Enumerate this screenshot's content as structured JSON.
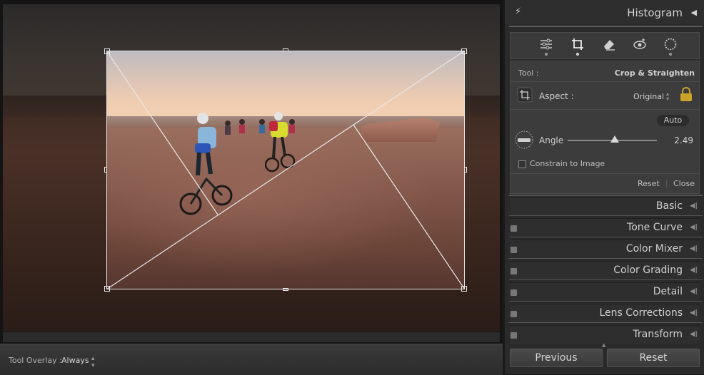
{
  "canvas": {
    "tool_overlay_label": "Tool Overlay :",
    "tool_overlay_value": "Always"
  },
  "right_panel": {
    "histogram_title": "Histogram",
    "tools": [
      "sliders-icon",
      "crop-icon",
      "eraser-icon",
      "redeye-icon",
      "mask-icon"
    ],
    "crop": {
      "tool_label": "Tool :",
      "tool_name": "Crop & Straighten",
      "aspect_label": "Aspect :",
      "aspect_value": "Original",
      "auto_label": "Auto",
      "angle_label": "Angle",
      "angle_value": "2.49",
      "angle_slider_fraction": 0.53,
      "constrain_label": "Constrain to Image",
      "reset_label": "Reset",
      "close_label": "Close"
    },
    "sections": [
      {
        "name": "Basic",
        "has_toggle": false
      },
      {
        "name": "Tone Curve",
        "has_toggle": true
      },
      {
        "name": "Color Mixer",
        "has_toggle": true
      },
      {
        "name": "Color Grading",
        "has_toggle": true
      },
      {
        "name": "Detail",
        "has_toggle": true
      },
      {
        "name": "Lens Corrections",
        "has_toggle": true
      },
      {
        "name": "Transform",
        "has_toggle": true
      }
    ],
    "previous_label": "Previous",
    "reset_label": "Reset"
  },
  "colors": {
    "panel_bg": "#2a2a2a",
    "lock_yellow": "#c9a227"
  }
}
